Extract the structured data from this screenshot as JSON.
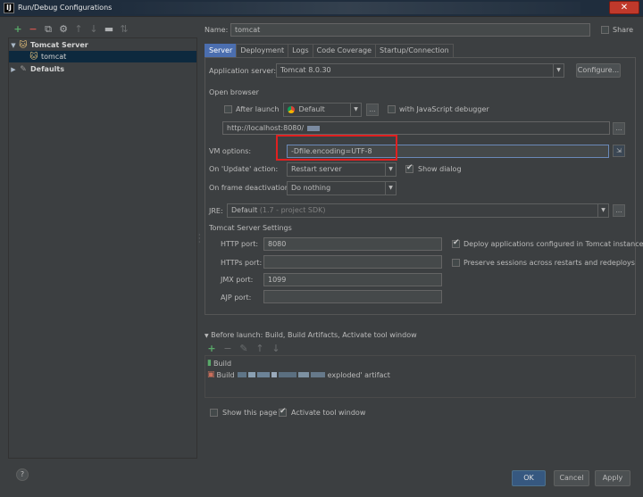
{
  "window": {
    "title": "Run/Debug Configurations",
    "app_icon": "IJ"
  },
  "tree": {
    "items": [
      {
        "label": "Tomcat Server",
        "icon": "tomcat-icon",
        "expanded": true
      },
      {
        "label": "tomcat",
        "icon": "tomcat-icon",
        "selected": true
      },
      {
        "label": "Defaults",
        "icon": "defaults-icon",
        "expanded": false
      }
    ]
  },
  "form": {
    "name_label": "Name:",
    "name_value": "tomcat",
    "share_label": "Share",
    "tabs": [
      "Server",
      "Deployment",
      "Logs",
      "Code Coverage",
      "Startup/Connection"
    ],
    "app_server_label": "Application server:",
    "app_server_value": "Tomcat 8.0.30",
    "configure_label": "Configure...",
    "open_browser_label": "Open browser",
    "after_launch_label": "After launch",
    "browser_value": "Default",
    "js_debugger_label": "with JavaScript debugger",
    "url_value": "http://localhost:8080/",
    "vm_options_label": "VM options:",
    "vm_options_value": "-Dfile.encoding=UTF-8",
    "on_update_label": "On 'Update' action:",
    "on_update_value": "Restart server",
    "show_dialog_label": "Show dialog",
    "on_frame_label": "On frame deactivation:",
    "on_frame_value": "Do nothing",
    "jre_label": "JRE:",
    "jre_value": "Default",
    "jre_hint": "(1.7 - project SDK)",
    "tomcat_settings_label": "Tomcat Server Settings",
    "http_port_label": "HTTP port:",
    "http_port_value": "8080",
    "https_port_label": "HTTPs port:",
    "https_port_value": "",
    "jmx_port_label": "JMX port:",
    "jmx_port_value": "1099",
    "ajp_port_label": "AJP port:",
    "ajp_port_value": "",
    "deploy_apps_label": "Deploy applications configured in Tomcat instance",
    "preserve_sessions_label": "Preserve sessions across restarts and redeploys",
    "before_launch_label": "Before launch: Build, Build Artifacts, Activate tool window",
    "before_items": [
      {
        "label": "Build"
      },
      {
        "label_prefix": "Build",
        "label_suffix": "exploded' artifact"
      }
    ],
    "show_page_label": "Show this page",
    "activate_tool_label": "Activate tool window"
  },
  "buttons": {
    "ok": "OK",
    "cancel": "Cancel",
    "apply": "Apply",
    "help": "?"
  }
}
